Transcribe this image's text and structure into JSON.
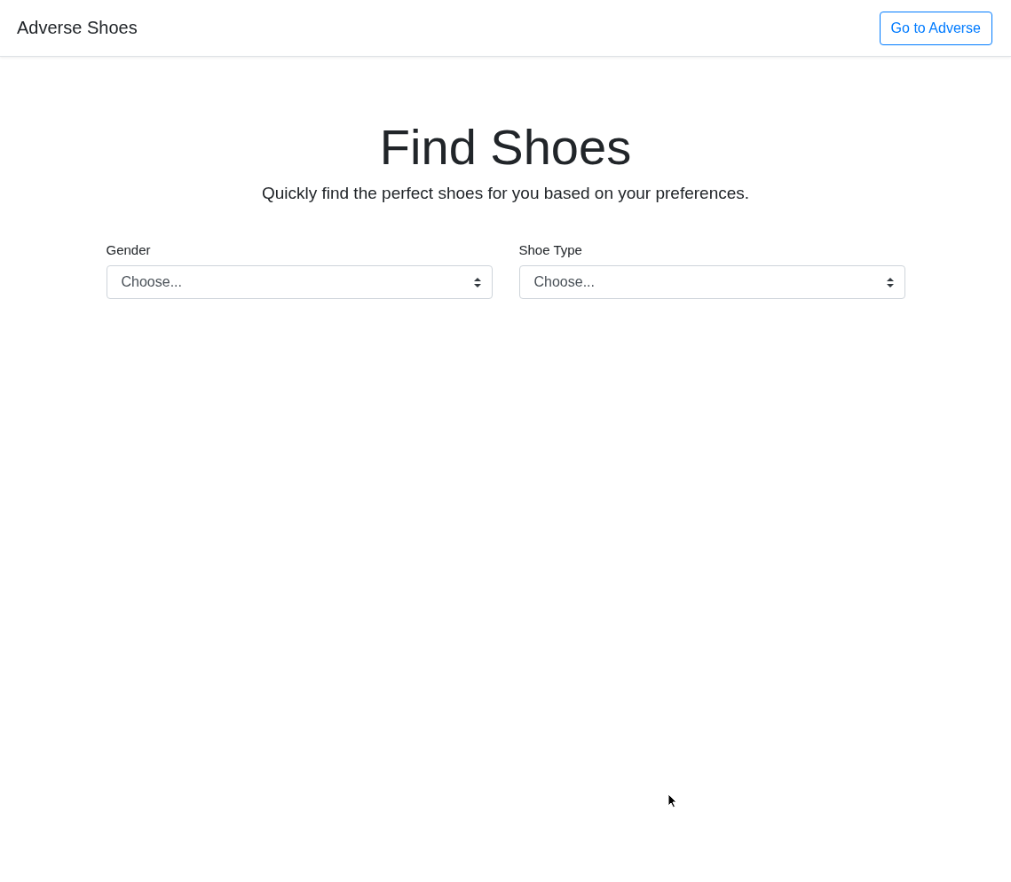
{
  "navbar": {
    "brand": "Adverse Shoes",
    "button": "Go to Adverse"
  },
  "hero": {
    "title": "Find Shoes",
    "subtitle": "Quickly find the perfect shoes for you based on your preferences."
  },
  "filters": [
    {
      "label": "Gender",
      "value": "Choose..."
    },
    {
      "label": "Shoe Type",
      "value": "Choose..."
    }
  ]
}
